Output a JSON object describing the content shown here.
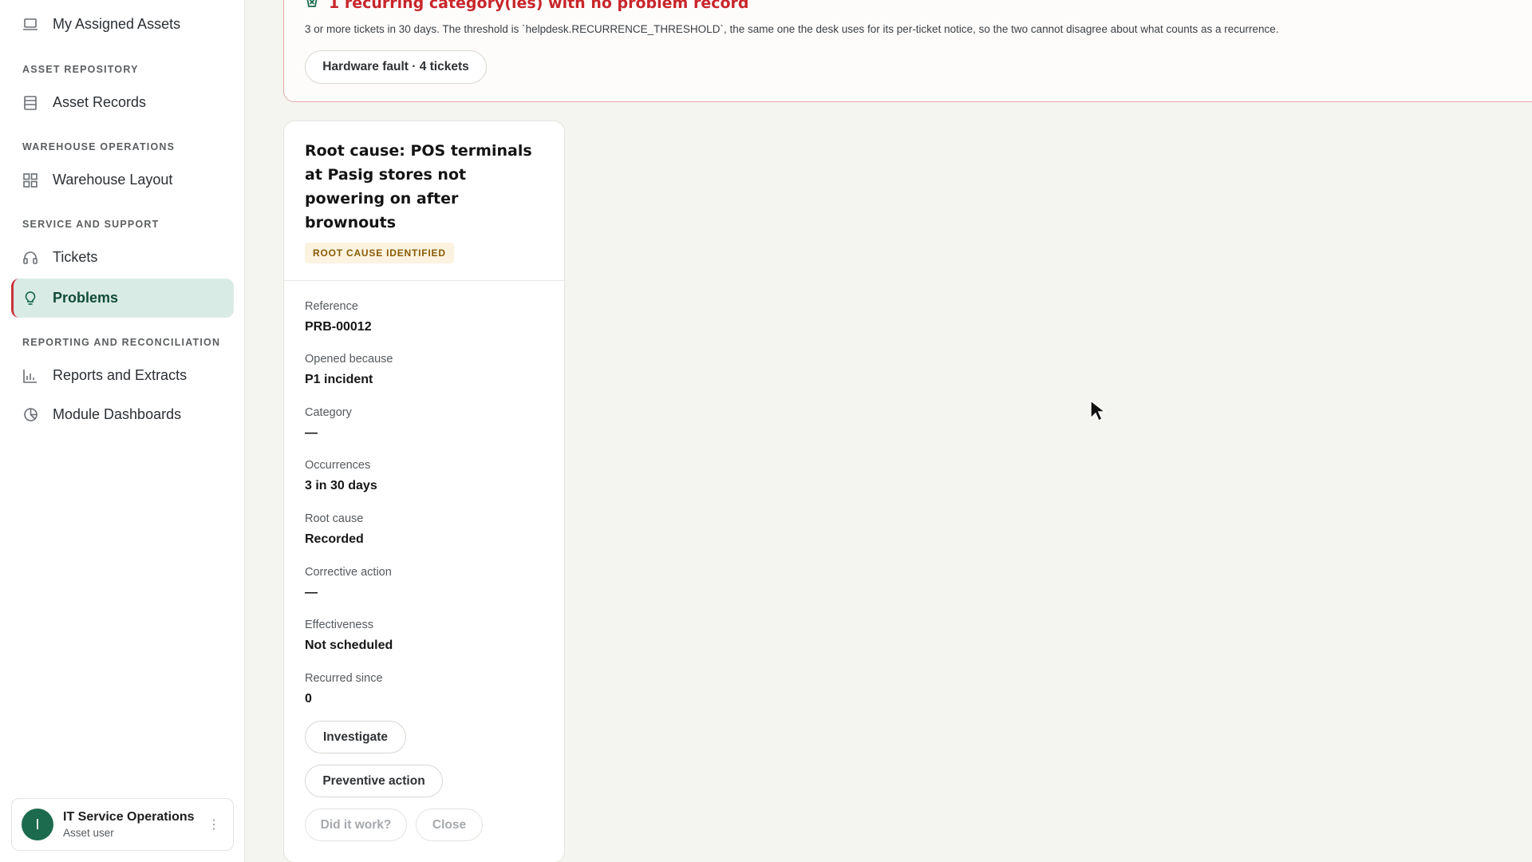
{
  "sidebar": {
    "top_item": "My Assigned Assets",
    "sections": [
      {
        "title": "ASSET REPOSITORY",
        "items": [
          "Asset Records"
        ]
      },
      {
        "title": "WAREHOUSE OPERATIONS",
        "items": [
          "Warehouse Layout"
        ]
      },
      {
        "title": "SERVICE AND SUPPORT",
        "items": [
          "Tickets",
          "Problems"
        ]
      },
      {
        "title": "REPORTING AND RECONCILIATION",
        "items": [
          "Reports and Extracts",
          "Module Dashboards"
        ]
      }
    ],
    "active_item": "Problems",
    "user": {
      "initial": "I",
      "name": "IT Service Operations",
      "role": "Asset user"
    }
  },
  "alert": {
    "title": "1 recurring category(ies) with no problem record",
    "description": "3 or more tickets in 30 days. The threshold is `helpdesk.RECURRENCE_THRESHOLD`, the same one the desk uses for its per-ticket notice, so the two cannot disagree about what counts as a recurrence.",
    "chip": "Hardware fault · 4 tickets"
  },
  "problem": {
    "title": "Root cause: POS terminals at Pasig stores not powering on after brownouts",
    "status": "ROOT CAUSE IDENTIFIED",
    "fields": [
      {
        "label": "Reference",
        "value": "PRB-00012"
      },
      {
        "label": "Opened because",
        "value": "P1 incident"
      },
      {
        "label": "Category",
        "value": "—"
      },
      {
        "label": "Occurrences",
        "value": "3 in 30 days"
      },
      {
        "label": "Root cause",
        "value": "Recorded"
      },
      {
        "label": "Corrective action",
        "value": "—"
      },
      {
        "label": "Effectiveness",
        "value": "Not scheduled"
      },
      {
        "label": "Recurred since",
        "value": "0"
      }
    ],
    "actions": {
      "investigate": "Investigate",
      "preventive": "Preventive action",
      "did_it_work": "Did it work?",
      "close": "Close"
    }
  },
  "colors": {
    "accent_green": "#1c6b4f",
    "alert_red": "#c8262c",
    "active_bg": "#d9ebe5",
    "badge_bg": "#fbf3df"
  }
}
